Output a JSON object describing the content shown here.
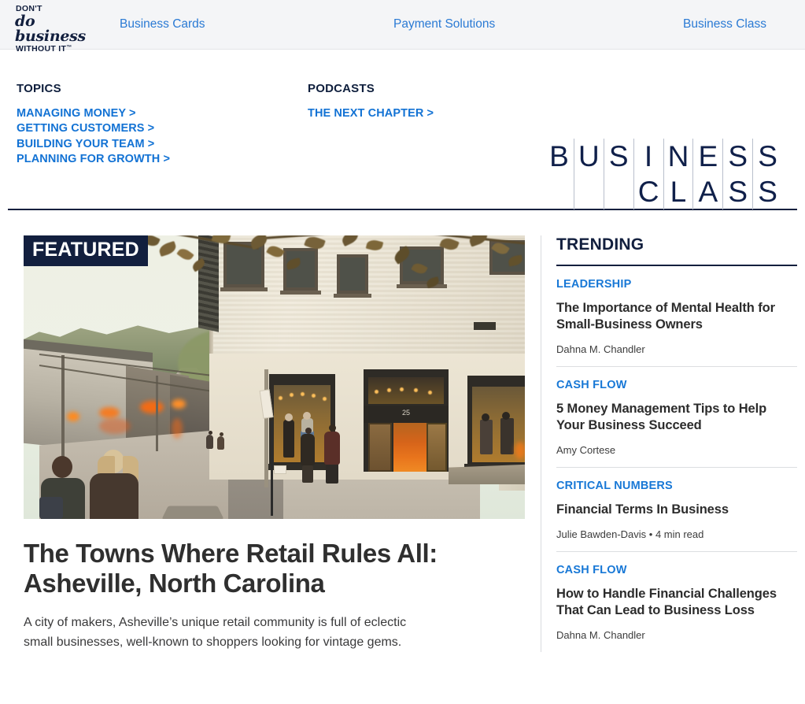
{
  "colors": {
    "nav_bg": "#f4f5f7",
    "link_blue": "#1878d6",
    "nav_blue": "#2a7ad4",
    "navy": "#121f3e",
    "body_text": "#2f2f2f"
  },
  "topnav": {
    "brand": {
      "line1": "DON'T",
      "line2": "do business",
      "line3": "WITHOUT IT",
      "tm": "™"
    },
    "links": [
      "Business Cards",
      "Payment Solutions",
      "Business Class"
    ]
  },
  "header": {
    "topics": {
      "heading": "TOPICS",
      "links": [
        "MANAGING MONEY >",
        "GETTING CUSTOMERS >",
        "BUILDING YOUR TEAM >",
        "PLANNING FOR GROWTH >"
      ]
    },
    "podcasts": {
      "heading": "PODCASTS",
      "links": [
        "THE NEXT CHAPTER >"
      ]
    },
    "logo": {
      "top_row": [
        "B",
        "U",
        "S",
        "I",
        "N",
        "E",
        "S",
        "S"
      ],
      "bottom_row": [
        "",
        "",
        "",
        "C",
        "L",
        "A",
        "S",
        "S"
      ],
      "full_text": "BUSINESS CLASS"
    }
  },
  "featured": {
    "badge": "FEATURED",
    "headline": "The Towns Where Retail Rules All: Asheville, North Carolina",
    "dek": "A city of makers, Asheville’s unique retail community is full of eclectic small businesses, well-known to shoppers looking for vintage gems.",
    "image": {
      "alt": "Downhill street view in Asheville with a cream brick storefront, lit display windows with mannequins, and pedestrians on the sidewalk",
      "address_number": "25"
    }
  },
  "trending": {
    "title": "TRENDING",
    "items": [
      {
        "category": "LEADERSHIP",
        "headline": "The Importance of Mental Health for Small-Business Owners",
        "meta": "Dahna M. Chandler"
      },
      {
        "category": "CASH FLOW",
        "headline": "5 Money Management Tips to Help Your Business Succeed",
        "meta": "Amy Cortese"
      },
      {
        "category": "CRITICAL NUMBERS",
        "headline": "Financial Terms In Business",
        "meta": "Julie Bawden-Davis • 4 min read"
      },
      {
        "category": "CASH FLOW",
        "headline": "How to Handle Financial Challenges That Can Lead to Business Loss",
        "meta": "Dahna M. Chandler"
      }
    ]
  }
}
